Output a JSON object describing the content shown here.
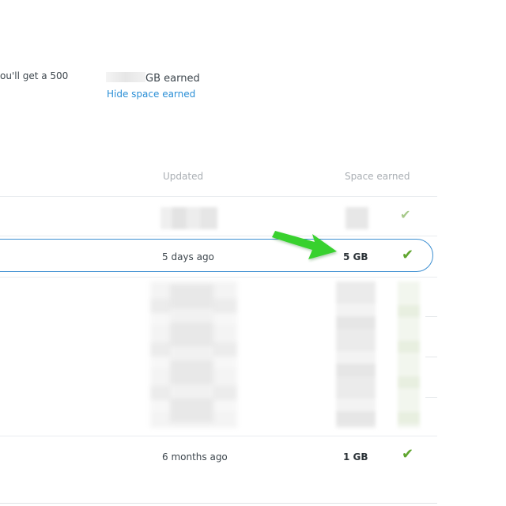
{
  "promo": {
    "text": "ou'll get a 500"
  },
  "summary": {
    "earned_suffix": "GB earned",
    "hide_link": "Hide space earned"
  },
  "table": {
    "headers": {
      "updated": "Updated",
      "space": "Space earned"
    },
    "highlighted_row": {
      "updated": "5 days ago",
      "space": "5 GB"
    },
    "last_row": {
      "updated": "6 months ago",
      "space": "1 GB"
    }
  },
  "colors": {
    "link": "#2b8fd6",
    "highlight_border": "#3d8fd1",
    "check": "#5fa52e",
    "arrow": "#39d12f"
  },
  "icons": {
    "check": "check-icon",
    "arrow": "green-arrow-annotation"
  }
}
